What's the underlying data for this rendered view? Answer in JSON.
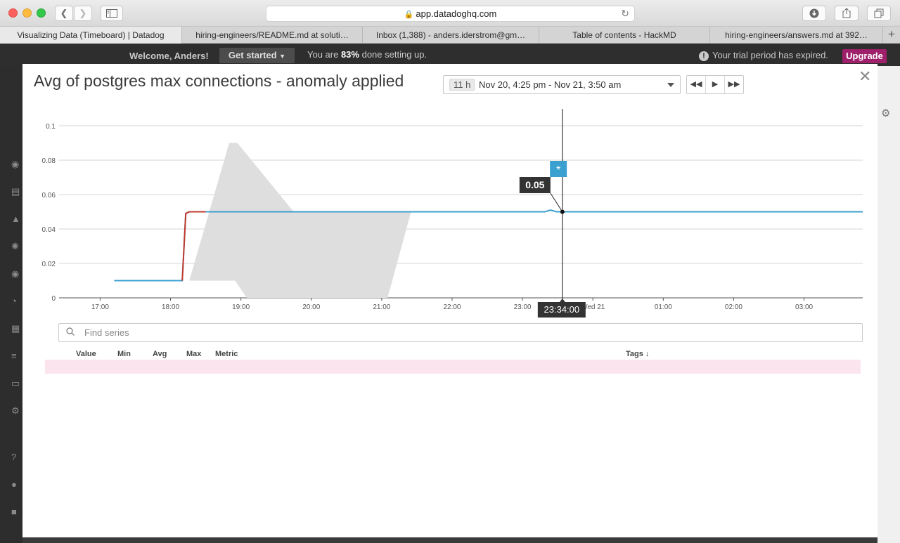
{
  "browser": {
    "url": "app.datadoghq.com",
    "tabs": [
      "Visualizing Data (Timeboard) | Datadog",
      "hiring-engineers/README.md at soluti…",
      "Inbox (1,388) - anders.iderstrom@gm…",
      "Table of contents - HackMD",
      "hiring-engineers/answers.md at 392…"
    ]
  },
  "app": {
    "welcome": "Welcome, Anders!",
    "get_started": "Get started",
    "setup_prefix": "You are ",
    "setup_percent": "83%",
    "setup_suffix": " done setting up.",
    "trial": "Your trial period has expired.",
    "upgrade": "Upgrade"
  },
  "modal": {
    "title": "Avg of postgres max connections - anomaly applied",
    "time_badge": "11 h",
    "time_range": "Nov 20, 4:25 pm - Nov 21, 3:50 am",
    "search_placeholder": "Find series",
    "columns": [
      "Value",
      "Min",
      "Avg",
      "Max",
      "Metric",
      "Tags ↓"
    ]
  },
  "colors": {
    "series_normal": "#3a9fcf",
    "series_anomaly": "#c0392b",
    "band": "#dedede",
    "marker": "#3aa0d0",
    "upgrade": "#9e1f6a"
  },
  "chart_data": {
    "type": "line",
    "ylim": [
      0,
      0.1
    ],
    "yticks": [
      "0",
      "0.02",
      "0.04",
      "0.06",
      "0.08",
      "0.1"
    ],
    "xticks": [
      "17:00",
      "18:00",
      "19:00",
      "20:00",
      "21:00",
      "22:00",
      "23:00",
      "Wed 21",
      "01:00",
      "02:00",
      "03:00"
    ],
    "x_time_start": "16:25",
    "x_time_end": "03:50",
    "series": [
      {
        "points": [
          [
            "17:12",
            0.01
          ],
          [
            "18:10",
            0.01
          ],
          [
            "18:13",
            0.049
          ],
          [
            "18:16",
            0.05
          ],
          [
            "23:19",
            0.05
          ],
          [
            "23:24",
            0.051
          ],
          [
            "23:29",
            0.05
          ],
          [
            "03:50",
            0.05
          ]
        ]
      }
    ],
    "anomaly_segment": [
      [
        "18:10",
        0.01
      ],
      [
        "18:13",
        0.049
      ],
      [
        "18:16",
        0.05
      ],
      [
        "18:30",
        0.05
      ]
    ],
    "band": {
      "upper": [
        [
          "18:16",
          0.01
        ],
        [
          "18:50",
          0.09
        ],
        [
          "18:57",
          0.09
        ],
        [
          "19:45",
          0.05
        ],
        [
          "21:25",
          0.05
        ]
      ],
      "lower": [
        [
          "18:16",
          0.01
        ],
        [
          "18:55",
          0.01
        ],
        [
          "19:05",
          0.0
        ],
        [
          "21:05",
          0.0
        ],
        [
          "21:25",
          0.05
        ]
      ]
    },
    "cursor": {
      "time": "23:34:00",
      "value": 0.05,
      "value_label": "0.05"
    },
    "event_marker": {
      "time": "23:30",
      "label": "*"
    }
  }
}
